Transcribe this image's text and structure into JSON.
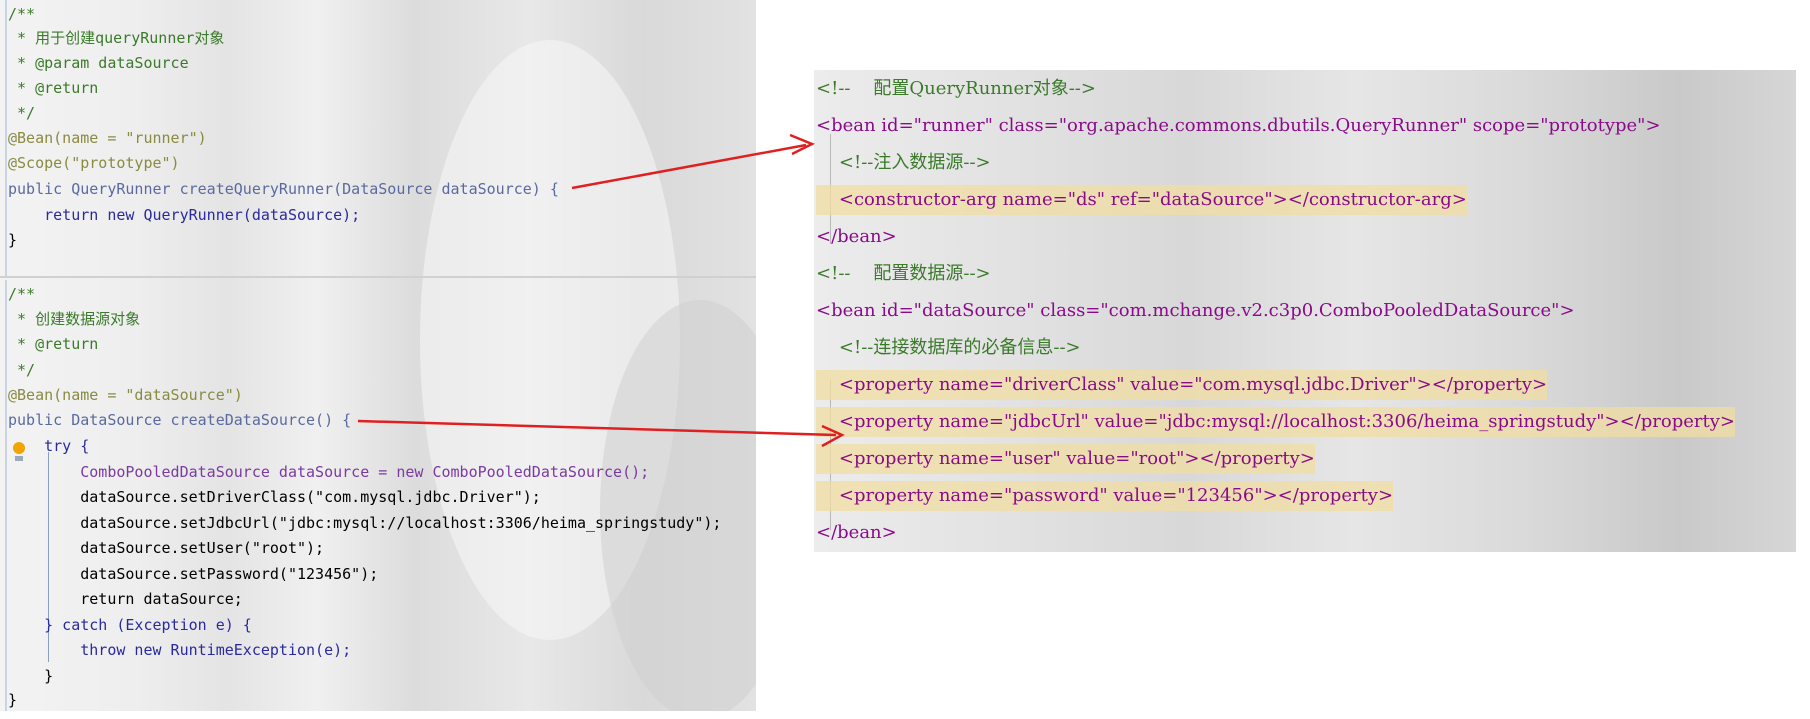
{
  "java": {
    "lines": [
      "/**",
      " * 用于创建queryRunner对象",
      " * @param dataSource",
      " * @return",
      " */",
      "@Bean(name = \"runner\")",
      "@Scope(\"prototype\")",
      "public QueryRunner createQueryRunner(DataSource dataSource) {",
      "    return new QueryRunner(dataSource);",
      "}",
      "/**",
      " * 创建数据源对象",
      " * @return",
      " */",
      "@Bean(name = \"dataSource\")",
      "public DataSource createDataSource() {",
      "    try {",
      "        ComboPooledDataSource dataSource = new ComboPooledDataSource();",
      "        dataSource.setDriverClass(\"com.mysql.jdbc.Driver\");",
      "        dataSource.setJdbcUrl(\"jdbc:mysql://localhost:3306/heima_springstudy\");",
      "        dataSource.setUser(\"root\");",
      "        dataSource.setPassword(\"123456\");",
      "        return dataSource;",
      "    } catch (Exception e) {",
      "        throw new RuntimeException(e);",
      "    }",
      "}"
    ]
  },
  "xml": {
    "lines": [
      "<!--    配置QueryRunner对象-->",
      "<bean id=\"runner\" class=\"org.apache.commons.dbutils.QueryRunner\" scope=\"prototype\">",
      "    <!--注入数据源-->",
      "    <constructor-arg name=\"ds\" ref=\"dataSource\"></constructor-arg>",
      "</bean>",
      "<!--    配置数据源-->",
      "<bean id=\"dataSource\" class=\"com.mchange.v2.c3p0.ComboPooledDataSource\">",
      "    <!--连接数据库的必备信息-->",
      "    <property name=\"driverClass\" value=\"com.mysql.jdbc.Driver\"></property>",
      "    <property name=\"jdbcUrl\" value=\"jdbc:mysql://localhost:3306/heima_springstudy\"></property>",
      "    <property name=\"user\" value=\"root\"></property>",
      "    <property name=\"password\" value=\"123456\"></property>",
      "</bean>"
    ]
  },
  "colors": {
    "arrow": "#e02020",
    "comment": "#3a7a2a",
    "string": "#1a8a1a",
    "tag": "#8a0a8a"
  },
  "icons": [
    "bulb-icon"
  ]
}
